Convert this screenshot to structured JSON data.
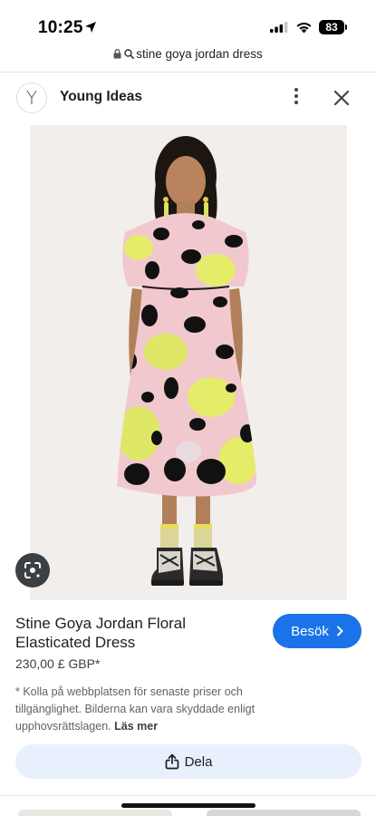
{
  "status_bar": {
    "time": "10:25",
    "battery": "83"
  },
  "url_bar": {
    "query": "stine goya jordan dress"
  },
  "source": {
    "logo_letter": "Y",
    "name": "Young Ideas"
  },
  "product": {
    "image_icon": "dress-photo",
    "title": "Stine Goya Jordan Floral Elasticated Dress",
    "price": "230,00 £ GBP*",
    "disclaimer": "* Kolla på webbplatsen för senaste priser och tillgänglighet. Bilderna kan vara skyddade enligt upphovsrättslagen.",
    "read_more": "Läs mer"
  },
  "actions": {
    "visit_label": "Besök",
    "share_label": "Dela"
  },
  "colors": {
    "accent": "#1a73e8",
    "share_bg": "#e8f0fe",
    "image_bg": "#f1eeeb"
  }
}
